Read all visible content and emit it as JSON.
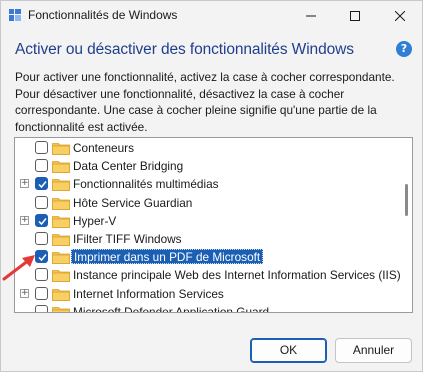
{
  "window": {
    "title": "Fonctionnalités de Windows"
  },
  "heading": "Activer ou désactiver des fonctionnalités Windows",
  "help_icon_glyph": "?",
  "description": "Pour activer une fonctionnalité, activez la case à cocher correspondante. Pour désactiver une fonctionnalité, désactivez la case à cocher correspondante. Une case à cocher pleine signifie qu'une partie de la fonctionnalité est activée.",
  "features": [
    {
      "label": "Conteneurs",
      "checked": false,
      "expandable": false
    },
    {
      "label": "Data Center Bridging",
      "checked": false,
      "expandable": false
    },
    {
      "label": "Fonctionnalités multimédias",
      "checked": true,
      "expandable": true
    },
    {
      "label": "Hôte Service Guardian",
      "checked": false,
      "expandable": false
    },
    {
      "label": "Hyper-V",
      "checked": true,
      "expandable": true
    },
    {
      "label": "IFilter TIFF Windows",
      "checked": false,
      "expandable": false
    },
    {
      "label": "Imprimer dans un PDF de Microsoft",
      "checked": true,
      "expandable": false,
      "selected": true
    },
    {
      "label": "Instance principale Web des Internet Information Services (IIS)",
      "checked": false,
      "expandable": false
    },
    {
      "label": "Internet Information Services",
      "checked": false,
      "expandable": true
    },
    {
      "label": "Microsoft Defender Application Guard",
      "checked": false,
      "expandable": false
    }
  ],
  "expander_glyph": "+",
  "buttons": {
    "ok": "OK",
    "cancel": "Annuler"
  },
  "colors": {
    "accent": "#1b5fb4",
    "heading": "#1f3f8c",
    "folder": "#f2c14e",
    "annotation_arrow": "#e53935"
  }
}
